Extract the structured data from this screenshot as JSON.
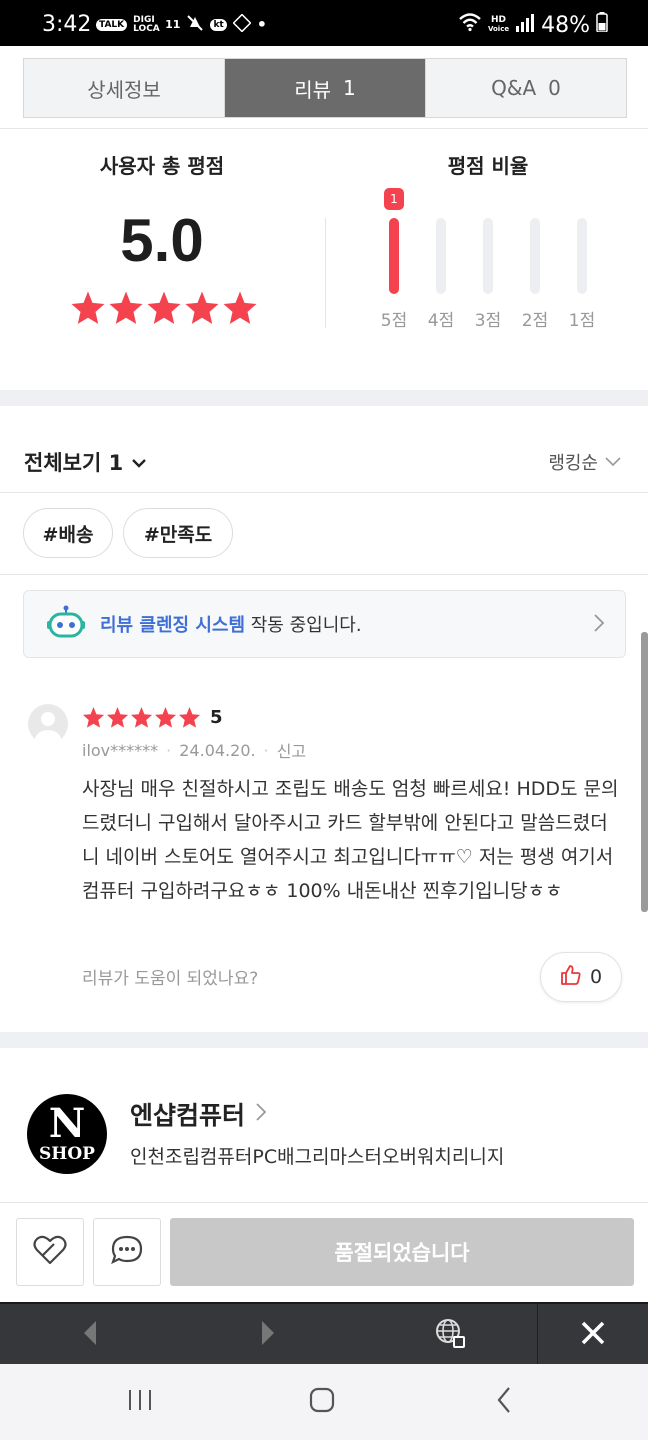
{
  "status_bar": {
    "time": "3:42",
    "left_icons": [
      "TALK",
      "DIGI LOCA",
      "11",
      "kt"
    ],
    "hd": "HD",
    "voice": "Voice",
    "battery": "48%"
  },
  "tabs": [
    {
      "label": "상세정보",
      "count": ""
    },
    {
      "label": "리뷰",
      "count": "1"
    },
    {
      "label": "Q&A",
      "count": "0"
    }
  ],
  "summary": {
    "total_title": "사용자 총 평점",
    "score": "5.0",
    "stars": 5,
    "ratio_title": "평점 비율",
    "bars": [
      {
        "label": "5점",
        "count": "1",
        "fill": 1.0
      },
      {
        "label": "4점",
        "count": "",
        "fill": 0
      },
      {
        "label": "3점",
        "count": "",
        "fill": 0
      },
      {
        "label": "2점",
        "count": "",
        "fill": 0
      },
      {
        "label": "1점",
        "count": "",
        "fill": 0
      }
    ]
  },
  "filter": {
    "title": "전체보기 1",
    "sort": "랭킹순",
    "chips": [
      "#배송",
      "#만족도"
    ]
  },
  "notice": {
    "strong": "리뷰 클렌징 시스템",
    "rest": " 작동 중입니다."
  },
  "review": {
    "score": "5",
    "user": "ilov******",
    "date": "24.04.20.",
    "report": "신고",
    "text": "사장님 매우 친절하시고 조립도 배송도 엄청 빠르세요! HDD도 문의드렸더니 구입해서 달아주시고 카드 할부밖에 안된다고 말씀드렸더니 네이버 스토어도 열어주시고 최고입니다ㅠㅠ♡ 저는 평생 여기서 컴퓨터 구입하려구요ㅎㅎ 100% 내돈내산 찐후기입니당ㅎㅎ",
    "helpful_question": "리뷰가 도움이 되었나요?",
    "likes": "0"
  },
  "shop": {
    "logo_top": "N",
    "logo_bottom": "SHOP",
    "name": "엔샵컴퓨터",
    "desc": "인천조립컴퓨터PC배그리마스터오버워치리니지"
  },
  "actions": {
    "soldout_label": "품절되었습니다"
  },
  "colors": {
    "accent_red": "#f4424e",
    "link_blue": "#3f6fd6",
    "active_tab": "#6b6b6b"
  }
}
